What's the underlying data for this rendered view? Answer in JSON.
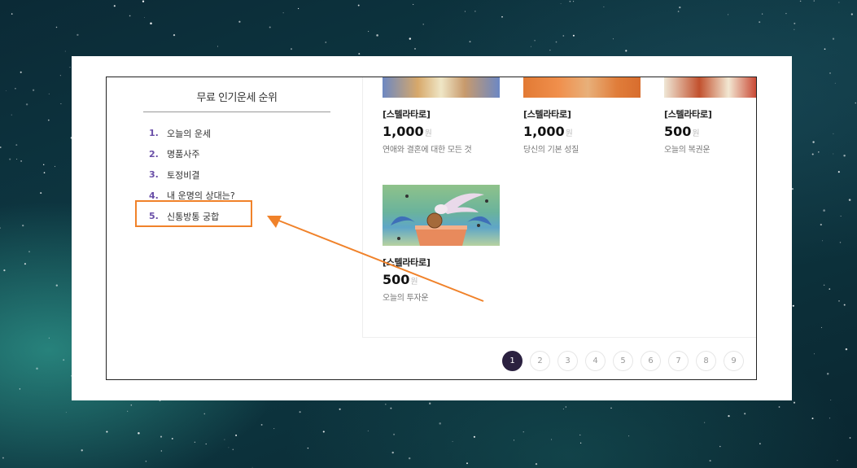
{
  "ranking": {
    "title": "무료 인기운세 순위",
    "items": [
      {
        "num": "1.",
        "label": "오늘의 운세"
      },
      {
        "num": "2.",
        "label": "명품사주"
      },
      {
        "num": "3.",
        "label": "토정비결"
      },
      {
        "num": "4.",
        "label": "내 운명의 상대는?"
      },
      {
        "num": "5.",
        "label": "신통방통 궁합"
      }
    ]
  },
  "products": [
    {
      "category": "[스텔라타로]",
      "price": "1,000",
      "unit": "원",
      "desc": "연애와 결혼에 대한 모든 것"
    },
    {
      "category": "[스텔라타로]",
      "price": "1,000",
      "unit": "원",
      "desc": "당신의 기본 성질"
    },
    {
      "category": "[스텔라타로]",
      "price": "500",
      "unit": "원",
      "desc": "오늘의 복권운"
    },
    {
      "category": "[스텔라타로]",
      "price": "500",
      "unit": "원",
      "desc": "오늘의 투자운"
    }
  ],
  "pagination": {
    "pages": [
      "1",
      "2",
      "3",
      "4",
      "5",
      "6",
      "7",
      "8",
      "9"
    ],
    "active": "1"
  },
  "colors": {
    "accent_purple": "#6a4fa8",
    "annotation_orange": "#f0822a",
    "active_page": "#2b2140"
  }
}
